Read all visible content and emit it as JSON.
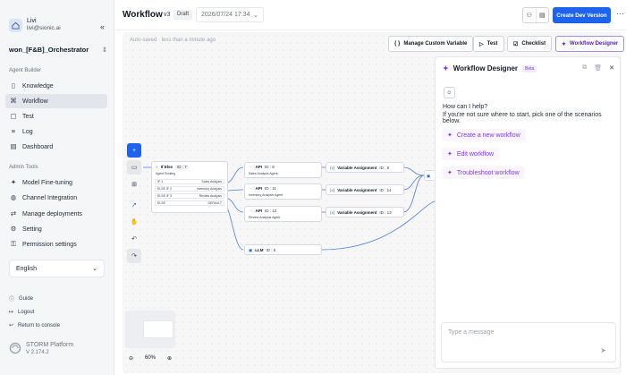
{
  "user": {
    "name": "Livi",
    "email": "livi@sionic.ai"
  },
  "project": {
    "name": "won_[F&B]_Orchestrator"
  },
  "sidebar": {
    "section_builder": "Agent Builder",
    "builder_items": [
      {
        "label": "Knowledge",
        "icon": "book-icon"
      },
      {
        "label": "Workflow",
        "icon": "workflow-icon"
      },
      {
        "label": "Test",
        "icon": "test-icon"
      },
      {
        "label": "Log",
        "icon": "log-icon"
      },
      {
        "label": "Dashboard",
        "icon": "dashboard-icon"
      }
    ],
    "section_admin": "Admin Tools",
    "admin_items": [
      {
        "label": "Model Fine-tuning",
        "icon": "wand-icon"
      },
      {
        "label": "Channel Integration",
        "icon": "globe-icon"
      },
      {
        "label": "Manage deployments",
        "icon": "deploy-icon"
      },
      {
        "label": "Setting",
        "icon": "gear-icon"
      },
      {
        "label": "Permission settings",
        "icon": "key-icon"
      }
    ],
    "language": "English",
    "guide": "Guide",
    "logout": "Logout",
    "return": "Return to console",
    "platform": "STORM Platform",
    "version": "V 2.174.2"
  },
  "header": {
    "title": "Workflow",
    "version": "v3",
    "status": "Draft",
    "datetime": "2026/07/24 17:34",
    "create_button": "Create Dev Version"
  },
  "canvas": {
    "autosave": "Auto-saved · less than a minute ago",
    "toolbar": {
      "manage_var": "Manage Custom Variable",
      "test": "Test",
      "checklist": "Checklist",
      "designer": "Workflow Designer"
    },
    "zoom": "60%",
    "nodes": {
      "ifelse_title": "If Else",
      "ifelse_id": "ID : 7",
      "ifelse_sub": "Agent Routing",
      "rows": [
        {
          "label": "IF 1",
          "value": "Sales Analysis"
        },
        {
          "label": "ELSE IF 2",
          "value": "Inventory Analysis"
        },
        {
          "label": "ELSE IF 3",
          "value": "Review Analysis"
        },
        {
          "label": "ELSE",
          "value": "DEFAULT"
        }
      ],
      "api": [
        {
          "title": "API",
          "id": "ID : 8",
          "sub": "Sales Analysis Agent"
        },
        {
          "title": "API",
          "id": "ID : 11",
          "sub": "Inventory Analysis Agent"
        },
        {
          "title": "API",
          "id": "ID : 12",
          "sub": "Review Analysis Agent"
        }
      ],
      "var": [
        {
          "title": "Variable Assignment",
          "id": "ID : 9"
        },
        {
          "title": "Variable Assignment",
          "id": "ID : 14"
        },
        {
          "title": "Variable Assignment",
          "id": "ID : 13"
        }
      ],
      "llm": {
        "title": "LLM",
        "id": "ID : 6"
      }
    }
  },
  "designer": {
    "title": "Workflow Designer",
    "badge": "Beta",
    "help1": "How can I help?",
    "help2": "If you're not sure where to start, pick one of the scenarios below.",
    "scenarios": [
      "Create a new workflow",
      "Edit workflow",
      "Troubleshoot workflow"
    ],
    "placeholder": "Type a message"
  }
}
